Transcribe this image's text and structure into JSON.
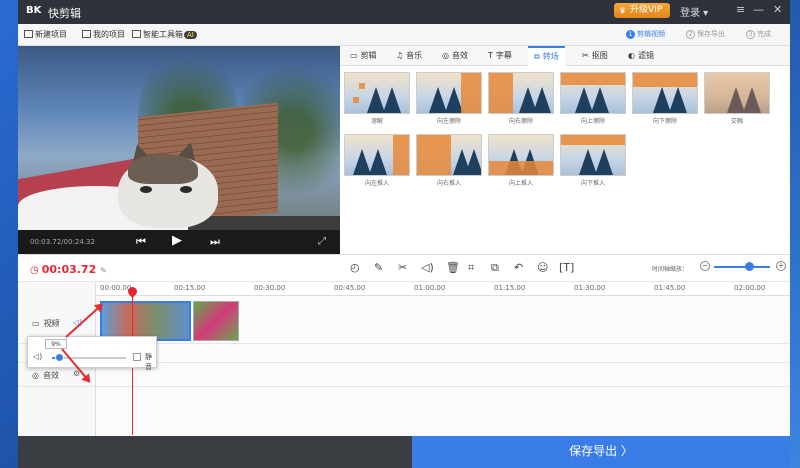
{
  "titlebar": {
    "logo": "BK",
    "app_name": "快剪辑",
    "vip_label": "升级VIP",
    "login_label": "登录",
    "minimize": "—",
    "close": "✕"
  },
  "menubar": {
    "new_project": "新建项目",
    "my_projects": "我的项目",
    "smart_toolbox": "智能工具箱",
    "ai_badge": "AI",
    "steps": [
      {
        "num": "1",
        "label": "剪辑视频"
      },
      {
        "num": "2",
        "label": "保存导出"
      },
      {
        "num": "3",
        "label": "完成"
      }
    ]
  },
  "preview": {
    "time_display": "00:03.72/00:24.32"
  },
  "tabs": [
    {
      "icon": "▭",
      "label": "剪辑"
    },
    {
      "icon": "♫",
      "label": "音乐"
    },
    {
      "icon": "◎",
      "label": "音效"
    },
    {
      "icon": "T",
      "label": "字幕"
    },
    {
      "icon": "⧉",
      "label": "转场"
    },
    {
      "icon": "✂",
      "label": "抠图"
    },
    {
      "icon": "◐",
      "label": "滤镜"
    }
  ],
  "active_tab": "转场",
  "transitions": [
    {
      "label": "溶解",
      "style": "dissolve"
    },
    {
      "label": "向左擦除",
      "style": "wipe-left"
    },
    {
      "label": "向右擦除",
      "style": "wipe-right"
    },
    {
      "label": "向上擦除",
      "style": "wipe-up"
    },
    {
      "label": "向下擦除",
      "style": "wipe-down"
    },
    {
      "label": "交融",
      "style": "blend"
    },
    {
      "label": "向左推入",
      "style": "push-left"
    },
    {
      "label": "向右推入",
      "style": "push-right"
    },
    {
      "label": "向上推入",
      "style": "push-up"
    },
    {
      "label": "向下推入",
      "style": "push-down"
    }
  ],
  "timeline": {
    "current_time": "00:03.72",
    "zoom_label": "时间轴缩放：",
    "ruler": [
      "00:00.00",
      "00:15.00",
      "00:30.00",
      "00:45.00",
      "01:00.00",
      "01:15.00",
      "01:30.00",
      "01:45.00",
      "02:00.00"
    ],
    "tracks": {
      "video": "视频",
      "audio": "音效"
    }
  },
  "volume_popup": {
    "percent": "9%",
    "percent_value": 9,
    "mute_label": "静音"
  },
  "bottom": {
    "export_label": "保存导出 〉"
  },
  "colors": {
    "accent": "#3b7de6",
    "time_red": "#e23333",
    "vip_orange": "#f0952a",
    "annotation_red": "#e02d2d"
  }
}
